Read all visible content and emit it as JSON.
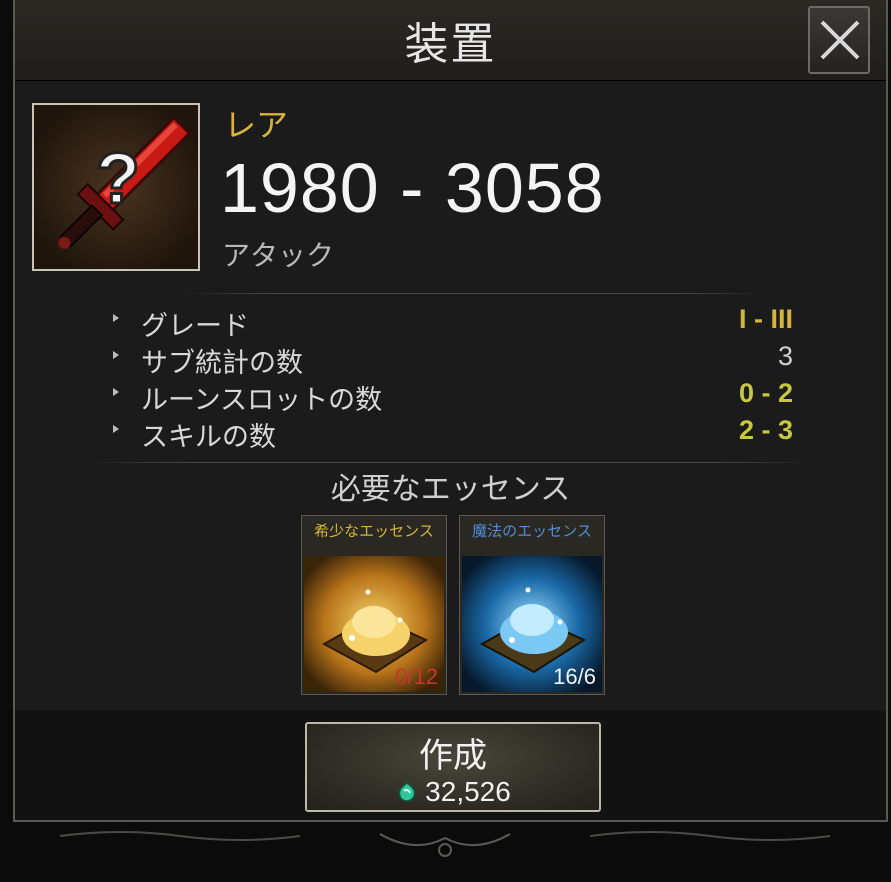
{
  "window": {
    "title": "装置"
  },
  "item": {
    "rarity": "レア",
    "rarity_color": "#d6b43c",
    "icon": "red-greatsword-unknown-icon",
    "stat_range": "1980 - 3058",
    "stat_label": "アタック"
  },
  "properties": [
    {
      "name": "グレード",
      "value": "I - III",
      "color": "#d6b43c"
    },
    {
      "name": "サブ統計の数",
      "value": "3",
      "color": "#d0d0d0"
    },
    {
      "name": "ルーンスロットの数",
      "value": "0 - 2",
      "color": "#c8c840"
    },
    {
      "name": "スキルの数",
      "value": "2 - 3",
      "color": "#c8c840"
    }
  ],
  "essence_section": {
    "heading": "必要なエッセンス",
    "items": [
      {
        "name": "希少なエッセンス",
        "count": "0/12",
        "name_color": "#d6b43c",
        "count_color": "#c8352c",
        "icon": "rare-essence-icon"
      },
      {
        "name": "魔法のエッセンス",
        "count": "16/6",
        "name_color": "#4f8ed8",
        "count_color": "#f2f2f2",
        "icon": "magic-essence-icon"
      }
    ]
  },
  "create_button": {
    "label": "作成",
    "cost": "32,526",
    "cost_icon": "gem-currency-icon"
  }
}
